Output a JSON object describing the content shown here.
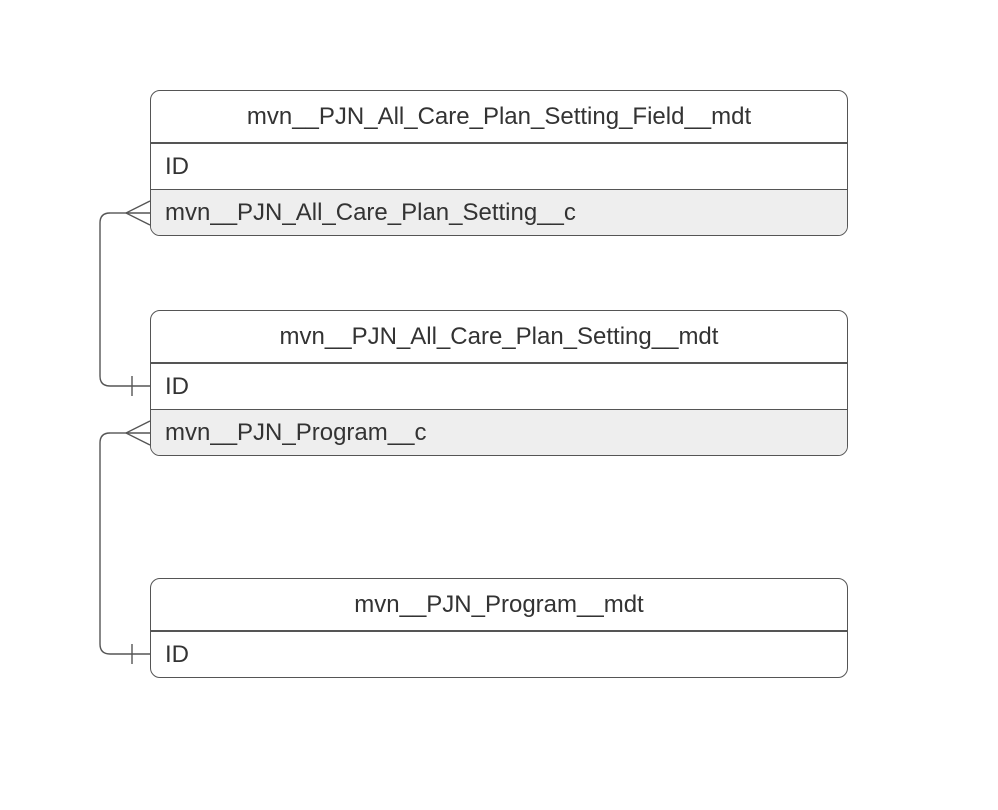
{
  "entities": {
    "e0": {
      "title": "mvn__PJN_All_Care_Plan_Setting_Field__mdt",
      "rows": [
        {
          "label": "ID",
          "shaded": false
        },
        {
          "label": "mvn__PJN_All_Care_Plan_Setting__c",
          "shaded": true
        }
      ]
    },
    "e1": {
      "title": "mvn__PJN_All_Care_Plan_Setting__mdt",
      "rows": [
        {
          "label": "ID",
          "shaded": false
        },
        {
          "label": "mvn__PJN_Program__c",
          "shaded": true
        }
      ]
    },
    "e2": {
      "title": "mvn__PJN_Program__mdt",
      "rows": [
        {
          "label": "ID",
          "shaded": false
        }
      ]
    }
  },
  "relations": [
    {
      "from": "e0.rows.1",
      "to": "e1.rows.0",
      "type": "many-to-one"
    },
    {
      "from": "e1.rows.1",
      "to": "e2.rows.0",
      "type": "many-to-one"
    }
  ],
  "layout": {
    "note": "Three stacked entity tables with crow's-foot (many) to barred (one) connectors on the left side."
  }
}
